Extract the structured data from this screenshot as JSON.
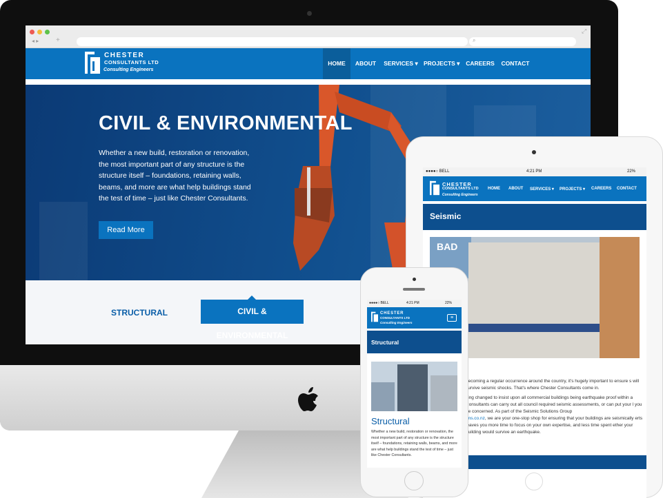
{
  "desktop": {
    "search_placeholder": "",
    "logo": {
      "line1": "CHESTER",
      "line2": "CONSULTANTS LTD",
      "tagline": "Consulting Engineers"
    },
    "nav": [
      {
        "label": "HOME"
      },
      {
        "label": "ABOUT"
      },
      {
        "label": "SERVICES ▾"
      },
      {
        "label": "PROJECTS ▾"
      },
      {
        "label": "CAREERS"
      },
      {
        "label": "CONTACT"
      }
    ],
    "hero": {
      "title": "CIVIL & ENVIRONMENTAL",
      "body": "Whether a new build, restoration or renovation, the most important part of any structure is the structure itself – foundations, retaining walls, beams, and more are what help buildings stand the test of time – just like Chester Consultants.",
      "button": "Read More"
    },
    "tabs": {
      "structural": "STRUCTURAL",
      "civil": "CIVIL & ENVIRONMENTAL"
    }
  },
  "tablet": {
    "status": {
      "carrier": "●●●●○ BELL",
      "time": "4:21 PM",
      "battery": "22%"
    },
    "logo": {
      "line1": "CHESTER",
      "line2": "CONSULTANTS LTD",
      "tagline": "Consulting Engineers"
    },
    "nav": [
      {
        "label": "HOME"
      },
      {
        "label": "ABOUT"
      },
      {
        "label": "SERVICES ▾"
      },
      {
        "label": "PROJECTS ▾"
      },
      {
        "label": "CAREERS"
      },
      {
        "label": "CONTACT"
      }
    ],
    "page_title": "Seismic",
    "paragraph1": "becoming a regular occurrence around the country, it's hugely important to ensure s will survive seismic shocks. That's where Chester Consultants come in.",
    "paragraph2": "ving changed to insist upon all commercial buildings being earthquake proof within a Consultants can carry out all council required seismic assessments, or can put your l you be concerned. As part of the Seismic Solutions Group",
    "paragraph3_link": "ons.co.nz",
    "paragraph3": ", we are your one-stop shop for ensuring that your buildings are seismically erts leaves you more time to focus on your own expertise, and less time spent ether your building would survive an earthquake.",
    "sign": "BAD"
  },
  "phone": {
    "status": {
      "carrier": "●●●●○ BELL",
      "time": "4:21 PM",
      "battery": "22%"
    },
    "logo": {
      "line1": "CHESTER",
      "line2": "CONSULTANTS LTD",
      "tagline": "Consulting Engineers"
    },
    "page_title": "Structural",
    "section_heading": "Structural",
    "body": "Whether a new build, restoration or renovation, the most important part of any structure is the structure itself – foundations, retaining walls, beams, and more are what help buildings stand the test of time – just like Chester Consultants."
  },
  "colors": {
    "brand_blue": "#0a73bf",
    "hero_dark": "#0b3a75",
    "excavator": "#d9572a"
  }
}
